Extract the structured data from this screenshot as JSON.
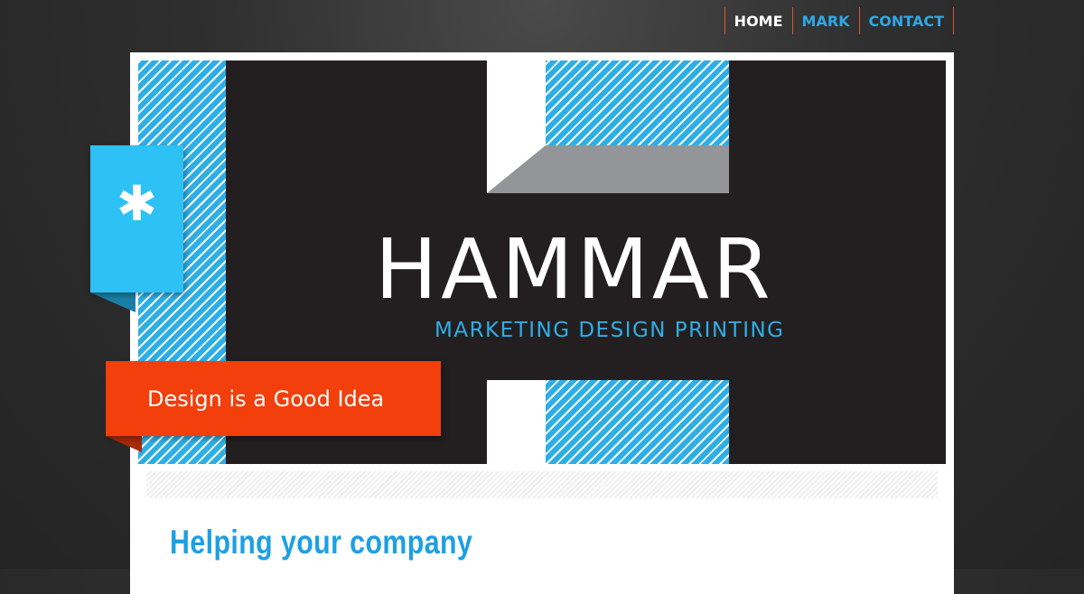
{
  "nav": {
    "items": [
      {
        "label": "HOME",
        "active": true
      },
      {
        "label": "MARK",
        "active": false
      },
      {
        "label": "CONTACT",
        "active": false
      }
    ],
    "active_color": "#ffffff",
    "link_color": "#2ea8e6",
    "divider_color": "#d9572b"
  },
  "hero": {
    "title": "HAMMAR",
    "subtitle": "MARKETING  DESIGN  PRINTING",
    "accent_color": "#2eaee6",
    "background_color": "#231f20"
  },
  "side_tab": {
    "icon": "asterisk-icon",
    "glyph": "✱",
    "color": "#2ec1f5"
  },
  "tagline": {
    "text": "Design is a Good Idea",
    "color": "#f23f0b"
  },
  "content": {
    "heading": "Helping your company"
  }
}
